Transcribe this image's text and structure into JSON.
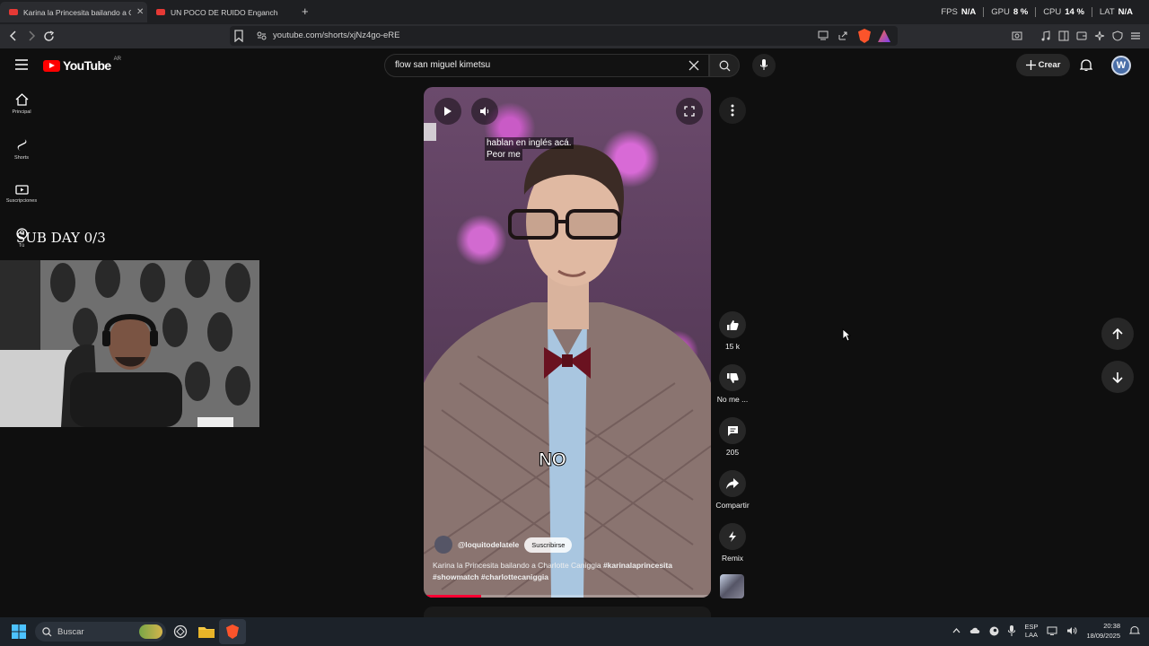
{
  "browser": {
    "tabs": [
      {
        "title": "Karina la Princesita bailando a Ch",
        "active": true
      },
      {
        "title": "UN POCO DE RUIDO Enganchado Za",
        "active": false
      }
    ],
    "new_tab": "+",
    "url": "youtube.com/shorts/xjNz4go-eRE",
    "perf": {
      "fps_label": "FPS",
      "fps_value": "N/A",
      "gpu_label": "GPU",
      "gpu_value": "8 %",
      "cpu_label": "CPU",
      "cpu_value": "14 %",
      "lat_label": "LAT",
      "lat_value": "N/A"
    }
  },
  "youtube": {
    "logo_text": "YouTube",
    "country_code": "AR",
    "search_value": "flow san miguel kimetsu",
    "create_label": "Crear",
    "avatar_letter": "W",
    "sidebar": [
      {
        "label": "Principal",
        "icon": "home-icon"
      },
      {
        "label": "Shorts",
        "icon": "shorts-icon"
      },
      {
        "label": "Suscripciones",
        "icon": "subscriptions-icon"
      },
      {
        "label": "Tú",
        "icon": "you-icon"
      }
    ]
  },
  "stream_overlay": {
    "text": "SUB DAY 0/3"
  },
  "short": {
    "subtitle_line1": "hablan en inglés acá.",
    "subtitle_line2": "Peor me",
    "burned_text": "NO",
    "channel": "@loquitodelatele",
    "subscribe_label": "Suscribirse",
    "description_plain": "Karina la Princesita bailando a Charlotte Caniggia ",
    "description_tag1": "#karinalaprincesita",
    "description_tag2": "#showmatch",
    "description_tag3": "#charlottecaniggia",
    "progress": 0.2
  },
  "actions": {
    "like_count": "15 k",
    "dislike_label": "No me ...",
    "comments_count": "205",
    "share_label": "Compartir",
    "remix_label": "Remix"
  },
  "taskbar": {
    "search_placeholder": "Buscar",
    "lang_line1": "ESP",
    "lang_line2": "LAA",
    "time": "20:38",
    "date": "18/09/2025"
  },
  "colors": {
    "yt_red": "#ff0000",
    "background": "#0f0f0f",
    "progress_red": "#ff0033"
  }
}
